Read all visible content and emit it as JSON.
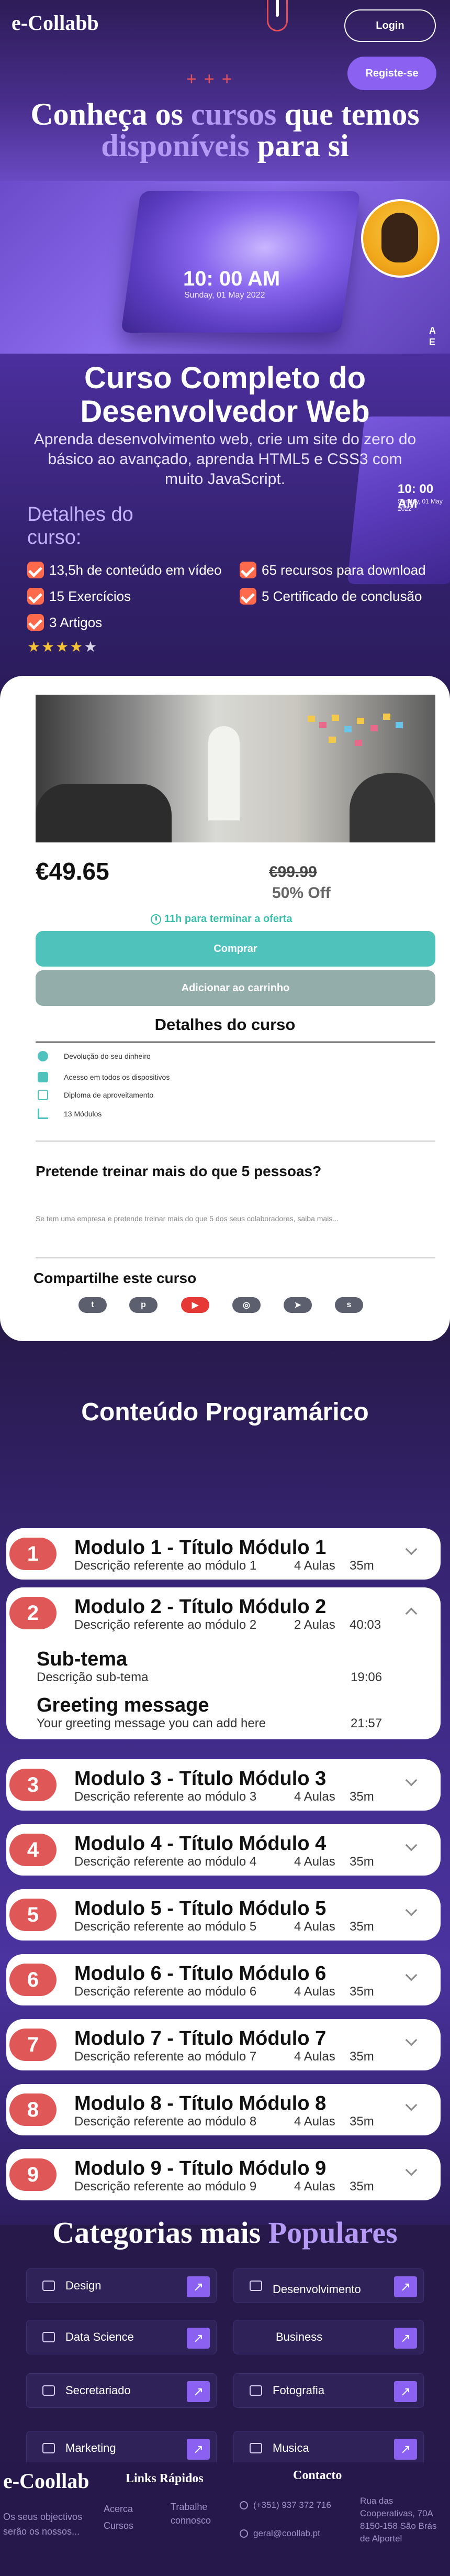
{
  "header": {
    "logo": "e-Collabb",
    "login_label": "Login",
    "register_label": "Registe-se",
    "plus_deco": "+++"
  },
  "hero": {
    "title_part1": "Conheça os ",
    "title_accent1": "cursos",
    "title_part2": " que temos ",
    "title_accent2": "disponíveis",
    "title_part3": " para si"
  },
  "banner": {
    "laptop_time": "10: 00 AM",
    "laptop_date": "Sunday, 01 May 2022",
    "side_text": "A\nE"
  },
  "course": {
    "title": "Curso Completo do Desenvolvedor Web",
    "description": "Aprenda desenvolvimento web, crie um site do zero do básico ao avançado, aprenda HTML5 e CSS3 com muito JavaScript.",
    "laptop2_time": "10: 00 AM",
    "laptop2_date": "Sunday, 01 May 2022",
    "details_heading": "Detalhes do curso:",
    "features": [
      "13,5h de conteúdo em vídeo",
      "65 recursos para download",
      "15 Exercícios",
      "5 Certificado de conclusão",
      "3 Artigos"
    ],
    "rating": 4,
    "rating_max": 5,
    "stars_on": "★★★★",
    "stars_off": "★"
  },
  "purchase": {
    "price_now": "€49.65",
    "price_old": "€99.99",
    "discount": "50% Off",
    "timer": "11h para terminar a oferta",
    "buy_label": "Comprar",
    "cart_label": "Adicionar ao carrinho",
    "details_title": "Detalhes do curso",
    "details": [
      "Devolução do seu dinheiro",
      "Acesso em todos os dispositivos",
      "Diploma de aproveitamento",
      "13 Módulos"
    ],
    "group_title": "Pretende treinar mais do que 5 pessoas?",
    "group_text": "Se tem uma empresa e pretende treinar mais do que 5 dos seus colaboradores, saiba mais...",
    "share_title": "Compartilhe este curso",
    "share_icons": [
      "twitter-icon",
      "pinterest-icon",
      "youtube-icon",
      "instagram-icon",
      "telegram-icon",
      "skype-icon"
    ]
  },
  "program": {
    "title": "Conteúdo Programárico",
    "modules": [
      {
        "num": "1",
        "title": "Modulo 1 - Título Módulo 1",
        "desc": "Descrição referente ao módulo 1",
        "aulas": "4 Aulas",
        "dur": "35m"
      },
      {
        "num": "2",
        "title": "Modulo 2 - Título Módulo 2",
        "desc": "Descrição referente ao módulo 2",
        "aulas": "2 Aulas",
        "dur": "40:03",
        "subs": [
          {
            "title": "Sub-tema",
            "desc": "Descrição sub-tema",
            "time": "19:06"
          },
          {
            "title": "Greeting message",
            "desc": "Your greeting message you can add here",
            "time": "21:57"
          }
        ]
      },
      {
        "num": "3",
        "title": "Modulo 3 - Título Módulo 3",
        "desc": "Descrição referente ao módulo 3",
        "aulas": "4 Aulas",
        "dur": "35m"
      },
      {
        "num": "4",
        "title": "Modulo 4 - Título Módulo 4",
        "desc": "Descrição referente ao módulo 4",
        "aulas": "4 Aulas",
        "dur": "35m"
      },
      {
        "num": "5",
        "title": "Modulo 5 - Título Módulo 5",
        "desc": "Descrição referente ao módulo 5",
        "aulas": "4 Aulas",
        "dur": "35m"
      },
      {
        "num": "6",
        "title": "Modulo 6 - Título Módulo 6",
        "desc": "Descrição referente ao módulo 6",
        "aulas": "4 Aulas",
        "dur": "35m"
      },
      {
        "num": "7",
        "title": "Modulo 7 - Título Módulo 7",
        "desc": "Descrição referente ao módulo 7",
        "aulas": "4 Aulas",
        "dur": "35m"
      },
      {
        "num": "8",
        "title": "Modulo 8 - Título Módulo 8",
        "desc": "Descrição referente ao módulo 8",
        "aulas": "4 Aulas",
        "dur": "35m"
      },
      {
        "num": "9",
        "title": "Modulo 9 - Título Módulo 9",
        "desc": "Descrição referente ao módulo 9",
        "aulas": "4 Aulas",
        "dur": "35m"
      }
    ]
  },
  "categories": {
    "title_part": "Categorias mais ",
    "title_accent": "Populares",
    "items": [
      {
        "label": "Design",
        "icon": "design-icon"
      },
      {
        "label": "Desenvolvimento",
        "icon": "database-icon"
      },
      {
        "label": "Data Science",
        "icon": "database-icon"
      },
      {
        "label": "Business",
        "icon": "business-icon"
      },
      {
        "label": "Secretariado",
        "icon": "secretary-icon"
      },
      {
        "label": "Fotografia",
        "icon": "photo-icon"
      },
      {
        "label": "Marketing",
        "icon": "marketing-icon"
      },
      {
        "label": "Musica",
        "icon": "music-icon"
      }
    ],
    "arrow": "↗"
  },
  "footer": {
    "logo": "e-Coollab",
    "tagline": "Os seus objectivos serão os nossos...",
    "links_title": "Links Rápidos",
    "link1": "Acerca",
    "link2": "Cursos",
    "link3": "Trabalhe connosco",
    "contact_title": "Contacto",
    "phone": "(+351) 937 372 716",
    "email": "geral@coollab.pt",
    "address": "Rua das Cooperativas, 70A 8150-158 São Brás de Alportel"
  },
  "colors": {
    "accent": "#8a61f0",
    "accent_text": "#b49af5",
    "module_number": "#e05757",
    "teal": "#4fc3bb",
    "star": "#f6c336"
  }
}
